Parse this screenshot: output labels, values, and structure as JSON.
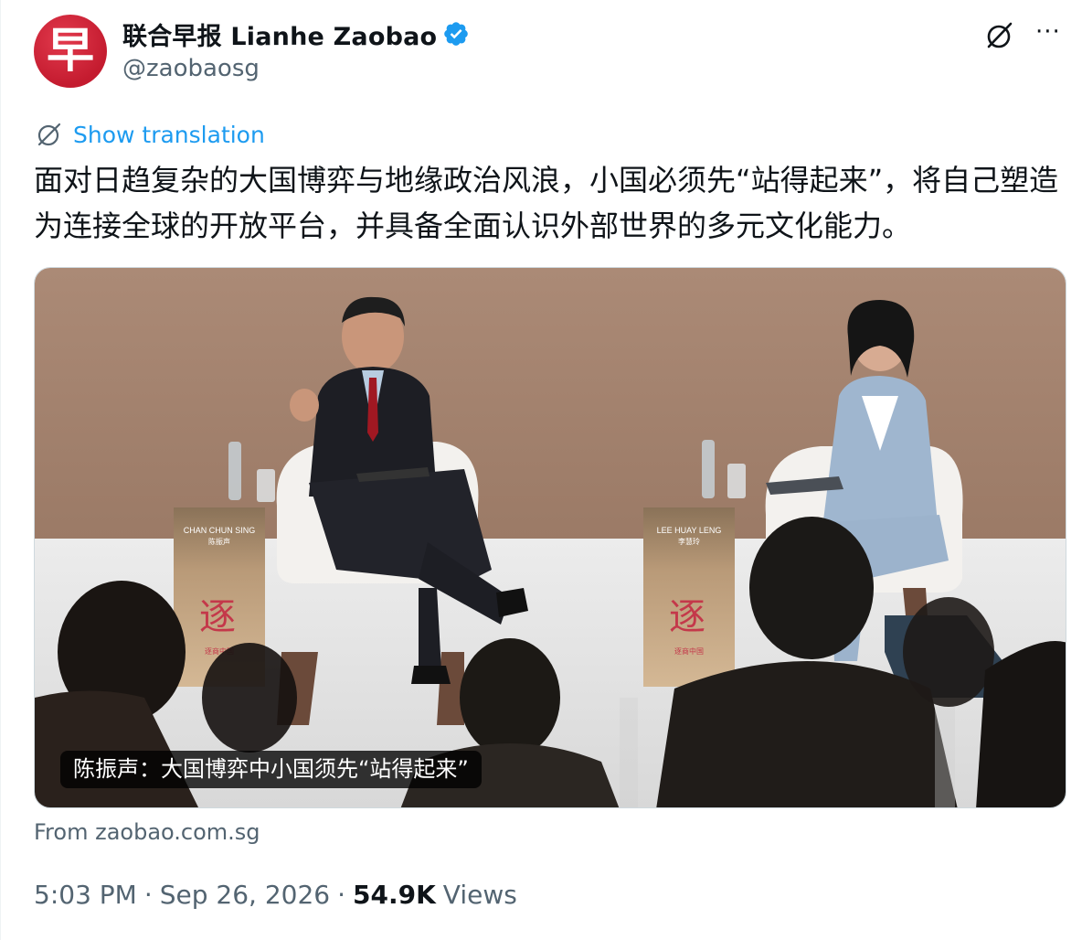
{
  "account": {
    "avatar_glyph": "早",
    "display_name": "联合早报 Lianhe Zaobao",
    "handle": "@zaobaosg",
    "verified_color": "#1d9bf0",
    "brand_color": "#c41b2f"
  },
  "icons": {
    "grok": "grok-icon",
    "more": "more-icon",
    "more_glyph": "···",
    "verified": "verified-badge-icon"
  },
  "translate": {
    "label": "Show translation"
  },
  "tweet": {
    "text": "面对日趋复杂的大国博弈与地缘政治风浪，小国必须先“站得起来”，将自己塑造为连接全球的开放平台，并具备全面认识外部世界的多元文化能力。"
  },
  "media": {
    "caption": "陈振声：大国博弈中小国须先“站得起来”",
    "left_placard": {
      "name": "CHAN CHUN SING",
      "name_cn": "陈振声",
      "logo_glyph": "逐",
      "logo_text": "逐商中国"
    },
    "right_placard": {
      "name": "LEE HUAY LENG",
      "name_cn": "李慧玲",
      "logo_glyph": "逐",
      "logo_text": "逐商中国"
    }
  },
  "source": {
    "text": "From zaobao.com.sg"
  },
  "meta": {
    "time": "5:03 PM",
    "separator": "·",
    "date": "Sep 26, 2026",
    "views_count": "54.9K",
    "views_label": "Views"
  }
}
